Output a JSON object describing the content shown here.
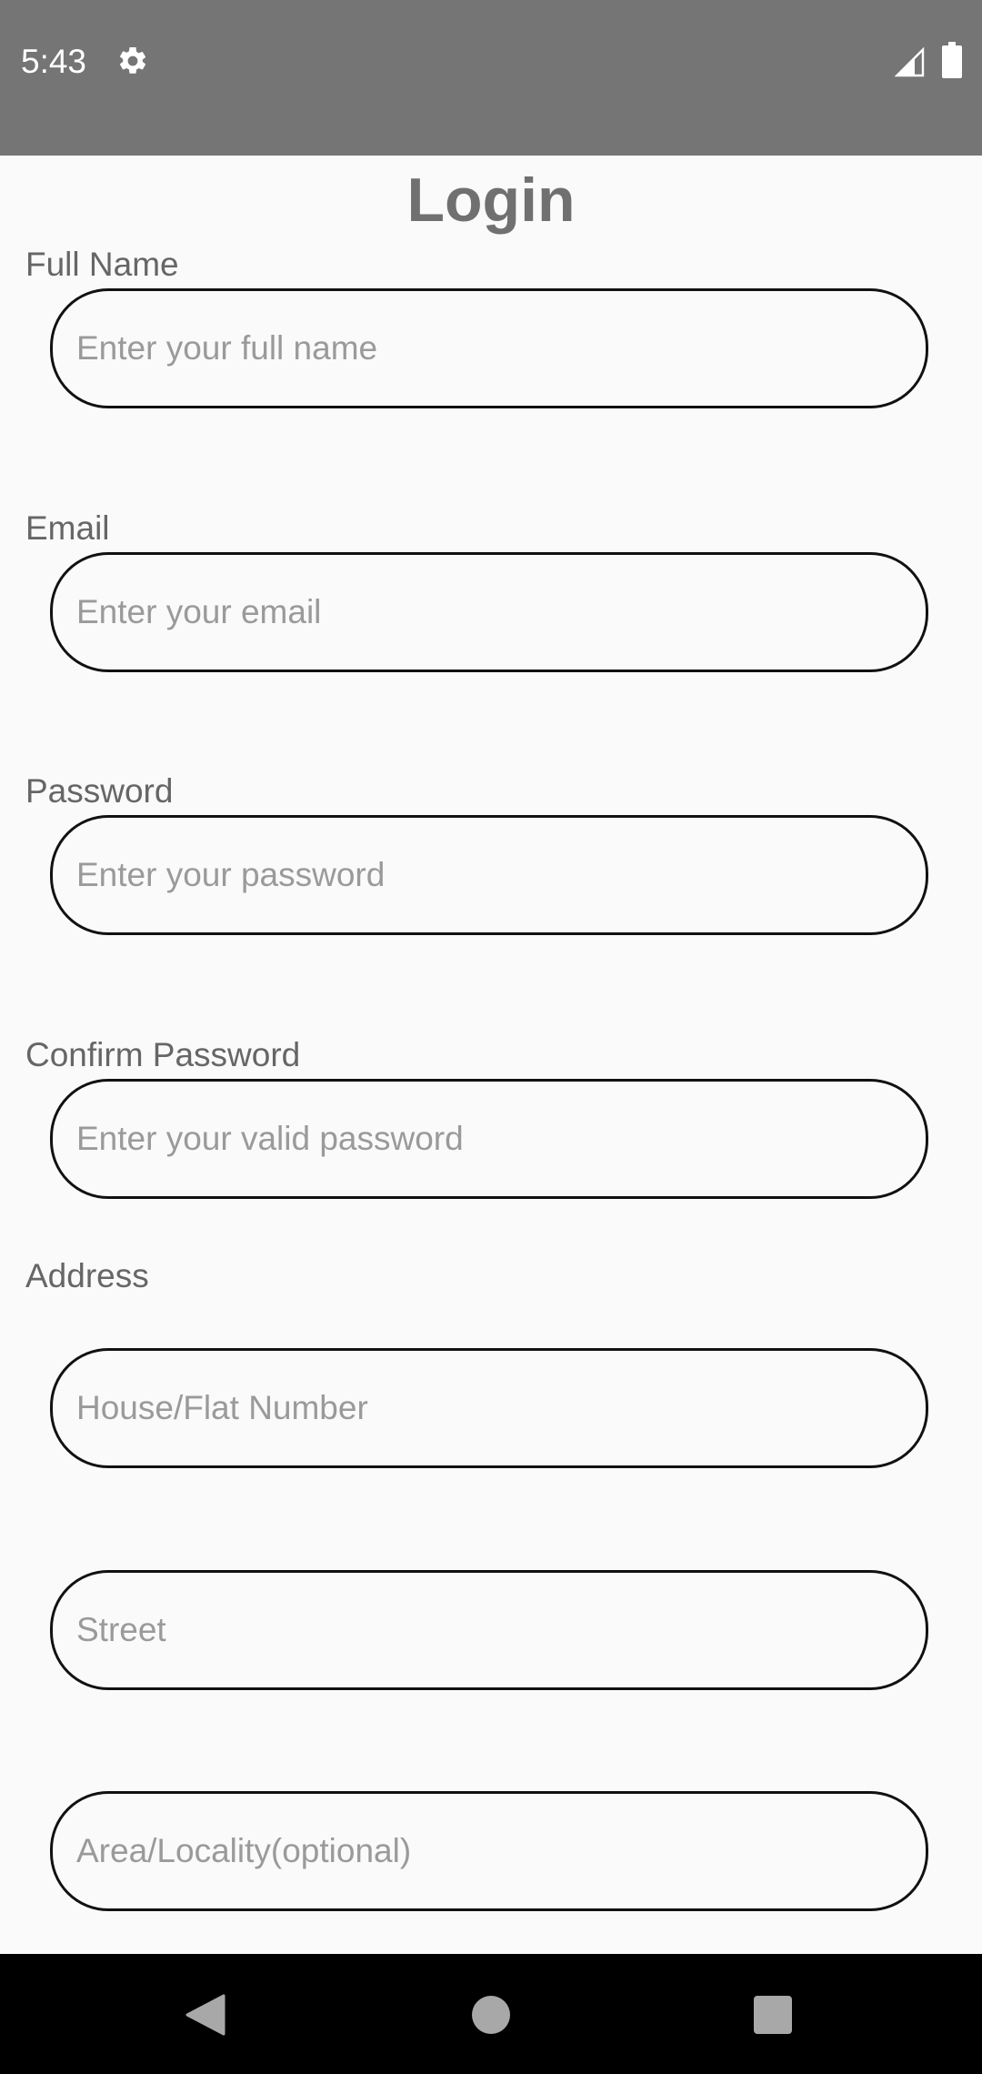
{
  "status_bar": {
    "time": "5:43",
    "icons": [
      "gear-icon",
      "signal-icon",
      "battery-icon"
    ]
  },
  "page": {
    "title": "Login"
  },
  "form": {
    "full_name": {
      "label": "Full Name",
      "placeholder": "Enter your full name",
      "value": ""
    },
    "email": {
      "label": "Email",
      "placeholder": "Enter your email",
      "value": ""
    },
    "password": {
      "label": "Password",
      "placeholder": "Enter your password",
      "value": ""
    },
    "confirm_password": {
      "label": "Confirm Password",
      "placeholder": "Enter your valid password",
      "value": ""
    },
    "address": {
      "label": "Address",
      "house": {
        "placeholder": "House/Flat Number",
        "value": ""
      },
      "street": {
        "placeholder": "Street",
        "value": ""
      },
      "area": {
        "placeholder": "Area/Locality(optional)",
        "value": ""
      }
    }
  },
  "nav_bar": {
    "icons": [
      "back-icon",
      "home-icon",
      "recents-icon"
    ]
  },
  "colors": {
    "status_bar": "#757575",
    "background": "#fafafa",
    "title": "#707070",
    "label": "#666666",
    "field_border": "#111111",
    "placeholder": "#9a9a9a",
    "nav_bar": "#000000"
  }
}
